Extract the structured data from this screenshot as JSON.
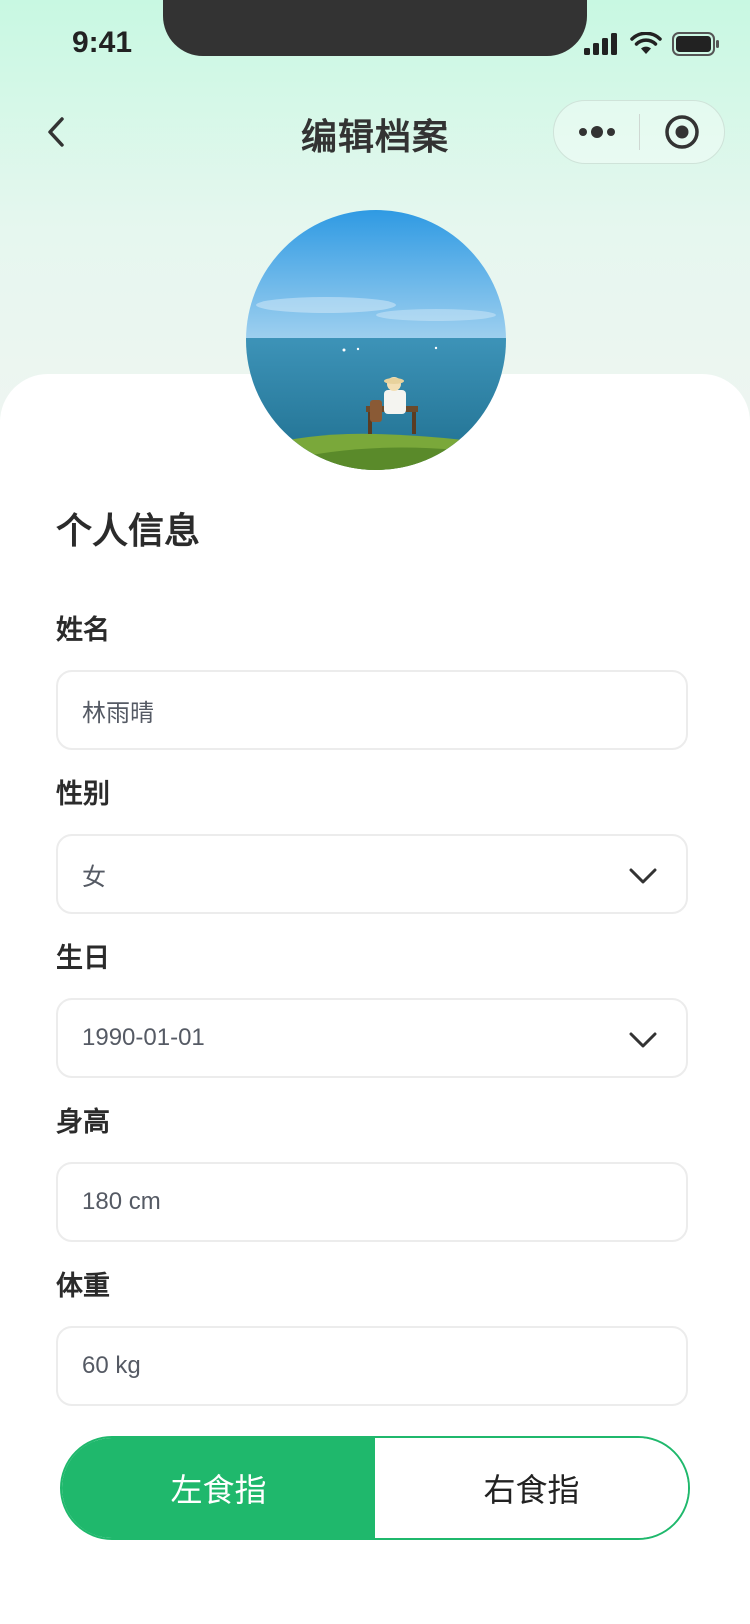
{
  "status_bar": {
    "time": "9:41"
  },
  "nav": {
    "title": "编辑档案"
  },
  "section_title": "个人信息",
  "fields": {
    "name": {
      "label": "姓名",
      "value": "林雨晴"
    },
    "gender": {
      "label": "性别",
      "value": "女"
    },
    "birthday": {
      "label": "生日",
      "value": "1990-01-01"
    },
    "height": {
      "label": "身高",
      "value": "180 cm"
    },
    "weight": {
      "label": "体重",
      "value": "60 kg"
    }
  },
  "finger_toggle": {
    "left": "左食指",
    "right": "右食指",
    "selected": "left"
  },
  "colors": {
    "accent": "#1fb86c",
    "header_gradient_top": "#c8f8e2"
  },
  "icons": [
    "back-icon",
    "more-dots-icon",
    "close-capsule-icon",
    "chevron-down-icon",
    "signal-icon",
    "wifi-icon",
    "battery-icon"
  ]
}
